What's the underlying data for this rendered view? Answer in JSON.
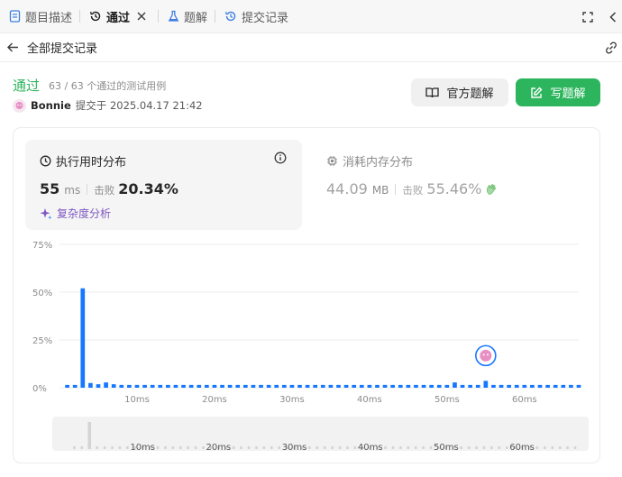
{
  "tabs": [
    {
      "label": "题目描述",
      "icon": "document-icon"
    },
    {
      "label": "通过",
      "icon": "history-icon",
      "active": true
    },
    {
      "label": "题解",
      "icon": "flask-icon"
    },
    {
      "label": "提交记录",
      "icon": "history-icon"
    }
  ],
  "subheader": {
    "title": "全部提交记录"
  },
  "submission": {
    "status": "通过",
    "testcases": "63 / 63 个通过的测试用例",
    "author": "Bonnie",
    "submitted_at": "提交于 2025.04.17 21:42"
  },
  "buttons": {
    "official_solution": "官方题解",
    "write_solution": "写题解"
  },
  "runtime": {
    "title": "执行用时分布",
    "value": "55",
    "unit": "ms",
    "beat_label": "击败",
    "beat_value": "20.34%",
    "complexity_label": "复杂度分析"
  },
  "memory": {
    "title": "消耗内存分布",
    "value": "44.09",
    "unit": "MB",
    "beat_label": "击败",
    "beat_value": "55.46%"
  },
  "colors": {
    "accent_green": "#2db55d",
    "bar_blue": "#1677ff",
    "complexity_purple": "#7e57c2"
  },
  "chart_data": {
    "type": "bar",
    "xlabel": "",
    "ylabel": "",
    "ylim": [
      0,
      75
    ],
    "xlim": [
      0,
      67
    ],
    "y_ticks": [
      "75%",
      "50%",
      "25%",
      "0%"
    ],
    "x_ticks": [
      "10ms",
      "20ms",
      "30ms",
      "40ms",
      "50ms",
      "60ms"
    ],
    "x_tick_values": [
      10,
      20,
      30,
      40,
      50,
      60
    ],
    "bar_width_ms": 1,
    "x": [
      1,
      2,
      3,
      4,
      5,
      6,
      7,
      8,
      9,
      10,
      11,
      12,
      13,
      14,
      15,
      16,
      17,
      18,
      19,
      20,
      21,
      22,
      23,
      24,
      25,
      26,
      27,
      28,
      29,
      30,
      31,
      32,
      33,
      34,
      35,
      36,
      37,
      38,
      39,
      40,
      41,
      42,
      43,
      44,
      45,
      46,
      47,
      48,
      49,
      50,
      51,
      52,
      53,
      54,
      55,
      56,
      57,
      58,
      59,
      60,
      61,
      62,
      63,
      64,
      65,
      66,
      67
    ],
    "values": [
      1.5,
      1.5,
      52,
      2.5,
      1.8,
      2.8,
      1.8,
      1.5,
      1.5,
      1.5,
      1.5,
      1.5,
      1.5,
      1.5,
      1.5,
      1.5,
      1.5,
      1.5,
      1.5,
      1.5,
      1.5,
      1.5,
      1.5,
      1.5,
      1.5,
      1.5,
      1.5,
      1.5,
      1.5,
      1.5,
      1.5,
      1.5,
      1.5,
      1.5,
      1.5,
      1.5,
      1.5,
      1.5,
      1.5,
      1.5,
      1.5,
      1.5,
      1.5,
      1.5,
      1.5,
      1.5,
      1.5,
      1.5,
      1.5,
      1.5,
      2.8,
      1.5,
      1.5,
      1.5,
      3.6,
      1.5,
      1.5,
      1.5,
      1.5,
      1.5,
      1.5,
      1.5,
      1.5,
      1.5,
      1.5,
      1.5,
      1.5
    ],
    "highlight_x": 55,
    "overview_x_ticks": [
      "10ms",
      "20ms",
      "30ms",
      "40ms",
      "50ms",
      "60ms"
    ]
  }
}
